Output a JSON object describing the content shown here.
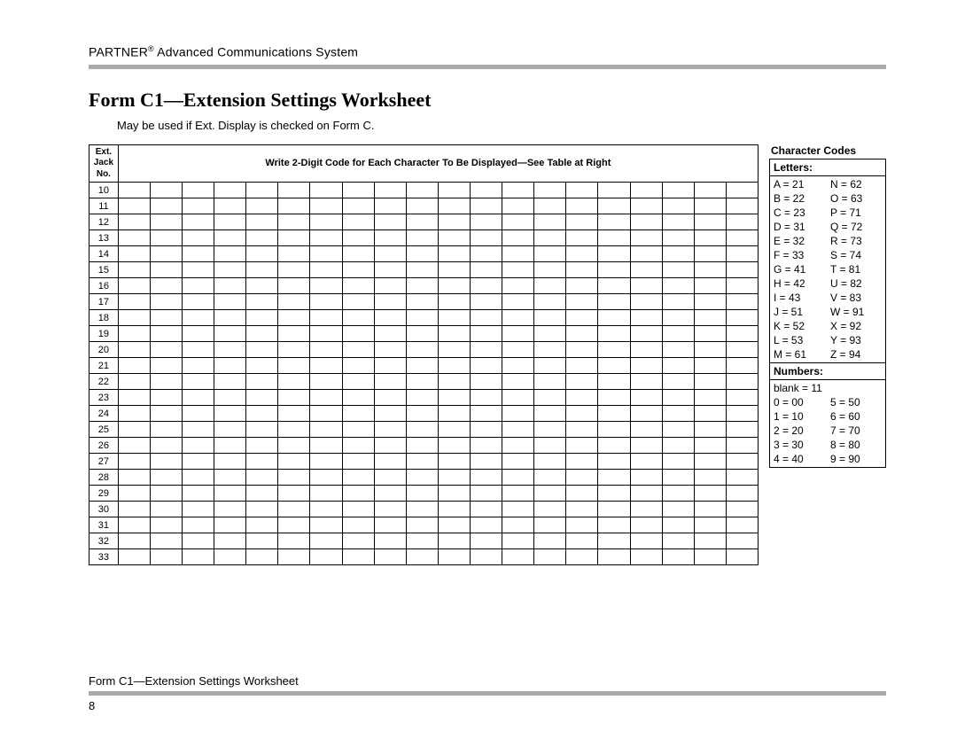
{
  "header": {
    "brand": "PARTNER",
    "brand_sup": "®",
    "system": " Advanced Communications System"
  },
  "title": "Form C1—Extension Settings Worksheet",
  "subnote": "May be used if Ext. Display is checked on Form C.",
  "worksheet": {
    "ext_header_l1": "Ext.",
    "ext_header_l2": "Jack",
    "ext_header_l3": "No.",
    "banner": "Write 2-Digit Code for Each Character To Be Displayed—See Table at Right",
    "rows": [
      "10",
      "11",
      "12",
      "13",
      "14",
      "15",
      "16",
      "17",
      "18",
      "19",
      "20",
      "21",
      "22",
      "23",
      "24",
      "25",
      "26",
      "27",
      "28",
      "29",
      "30",
      "31",
      "32",
      "33"
    ],
    "code_columns": 20
  },
  "codes": {
    "title": "Character Codes",
    "letters_label": "Letters:",
    "letters_col1": [
      "A = 21",
      "B = 22",
      "C = 23",
      "D = 31",
      "E = 32",
      "F = 33",
      "G = 41",
      "H = 42",
      "I = 43",
      "J = 51",
      "K = 52",
      "L = 53",
      "M = 61"
    ],
    "letters_col2": [
      "N = 62",
      "O = 63",
      "P = 71",
      "Q = 72",
      "R = 73",
      "S = 74",
      "T = 81",
      "U = 82",
      "V = 83",
      "W = 91",
      "X = 92",
      "Y = 93",
      "Z = 94"
    ],
    "numbers_label": "Numbers:",
    "numbers_blank": "blank = 11",
    "numbers_col1": [
      "0 = 00",
      "1 = 10",
      "2 = 20",
      "3 = 30",
      "4 = 40"
    ],
    "numbers_col2": [
      "5 = 50",
      "6 = 60",
      "7 = 70",
      "8 = 80",
      "9 = 90"
    ]
  },
  "footer": {
    "title": "Form C1—Extension Settings Worksheet",
    "page": "8"
  }
}
